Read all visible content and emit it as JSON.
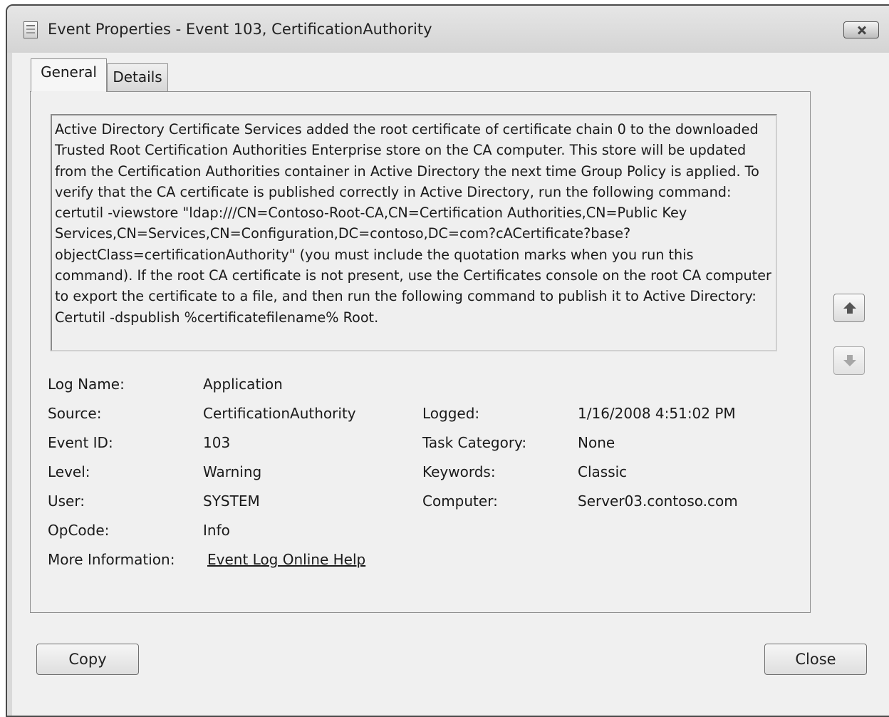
{
  "window": {
    "title": "Event Properties - Event 103, CertificationAuthority"
  },
  "tabs": [
    {
      "label": "General",
      "selected": true
    },
    {
      "label": "Details",
      "selected": false
    }
  ],
  "description": "Active Directory Certificate Services added the root certificate of certificate chain 0 to the downloaded Trusted Root Certification Authorities Enterprise store on the CA computer. This store will be updated from the Certification Authorities container in Active Directory the next time Group Policy is applied. To verify that the CA certificate is published correctly in Active Directory, run the following command: certutil -viewstore \"ldap:///CN=Contoso-Root-CA,CN=Certification Authorities,CN=Public Key Services,CN=Services,CN=Configuration,DC=contoso,DC=com?cACertificate?base?objectClass=certificationAuthority\" (you must include the quotation marks when you run this command). If the root CA certificate is not present, use the Certificates console on the root CA computer to export the certificate to a file, and then run the following command to publish it to Active Directory: Certutil -dspublish %certificatefilename% Root.",
  "fields": {
    "log_name": {
      "label": "Log Name:",
      "value": "Application"
    },
    "source": {
      "label": "Source:",
      "value": "CertificationAuthority"
    },
    "logged": {
      "label": "Logged:",
      "value": "1/16/2008 4:51:02 PM"
    },
    "event_id": {
      "label": "Event ID:",
      "value": "103"
    },
    "task_category": {
      "label": "Task Category:",
      "value": "None"
    },
    "level": {
      "label": "Level:",
      "value": "Warning"
    },
    "keywords": {
      "label": "Keywords:",
      "value": "Classic"
    },
    "user": {
      "label": "User:",
      "value": "SYSTEM"
    },
    "computer": {
      "label": "Computer:",
      "value": "Server03.contoso.com"
    },
    "opcode": {
      "label": "OpCode:",
      "value": "Info"
    },
    "more_info": {
      "label": "More Information:",
      "value": "Event Log Online Help"
    }
  },
  "buttons": {
    "copy": "Copy",
    "close": "Close"
  },
  "icons": {
    "title": "event-viewer-icon",
    "close": "close-icon",
    "previous": "arrow-up-icon",
    "next": "arrow-down-icon"
  }
}
